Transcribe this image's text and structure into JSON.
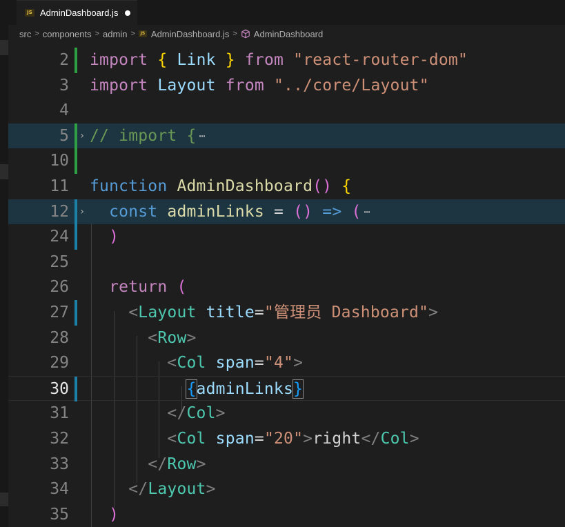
{
  "tab": {
    "file_icon": "JS",
    "title": "AdminDashboard.js"
  },
  "breadcrumb": {
    "items": [
      "src",
      "components",
      "admin",
      "AdminDashboard.js",
      "AdminDashboard"
    ],
    "file_icon": "JS"
  },
  "editor": {
    "lines": [
      {
        "n": "2"
      },
      {
        "n": "3"
      },
      {
        "n": "4"
      },
      {
        "n": "5"
      },
      {
        "n": "10"
      },
      {
        "n": "11"
      },
      {
        "n": "12"
      },
      {
        "n": "24"
      },
      {
        "n": "25"
      },
      {
        "n": "26"
      },
      {
        "n": "27"
      },
      {
        "n": "28"
      },
      {
        "n": "29"
      },
      {
        "n": "30"
      },
      {
        "n": "31"
      },
      {
        "n": "32"
      },
      {
        "n": "33"
      },
      {
        "n": "34"
      },
      {
        "n": "35"
      }
    ],
    "active_line": "30",
    "tokens": {
      "import": "import",
      "from": "from",
      "link": "Link",
      "lb": "{",
      "rb": "}",
      "react_router": "\"react-router-dom\"",
      "layout_ident": "Layout",
      "layout_path": "\"../core/Layout\"",
      "comment_import": "// import {",
      "ellipsis": "⋯",
      "function": "function",
      "fn_name": "AdminDashboard",
      "parens": "()",
      "const": "const",
      "admin_links": "adminLinks",
      "eq": "=",
      "arrow": "=>",
      "lparen": "(",
      "rparen": ")",
      "return": "return",
      "lt": "<",
      "lt_slash": "</",
      "gt": ">",
      "title_attr": "title",
      "title_value": "\"管理员 Dashboard\"",
      "row_tag": "Row",
      "col_tag": "Col",
      "span_attr": "span",
      "span4": "\"4\"",
      "span20": "\"20\"",
      "right_text": "right",
      "equals": "="
    }
  },
  "colors": {
    "background": "#1e1e1e",
    "keyword_purple": "#c586c0",
    "string": "#ce9178",
    "variable": "#9cdcfe",
    "function": "#dcdcaa",
    "storage_blue": "#569cd6",
    "component": "#4ec9b0",
    "bracket_gold": "#ffd700",
    "bracket_orchid": "#da70d6",
    "comment": "#6a9955",
    "git_added": "#2ea043",
    "git_modified": "#1b81a8"
  },
  "icons": {
    "tab_file": "js-file-icon",
    "modified": "unsaved-dot-icon",
    "breadcrumb_separator": "chevron-right-icon",
    "symbol": "cube-symbol-icon",
    "fold": "fold-chevron-icon"
  }
}
